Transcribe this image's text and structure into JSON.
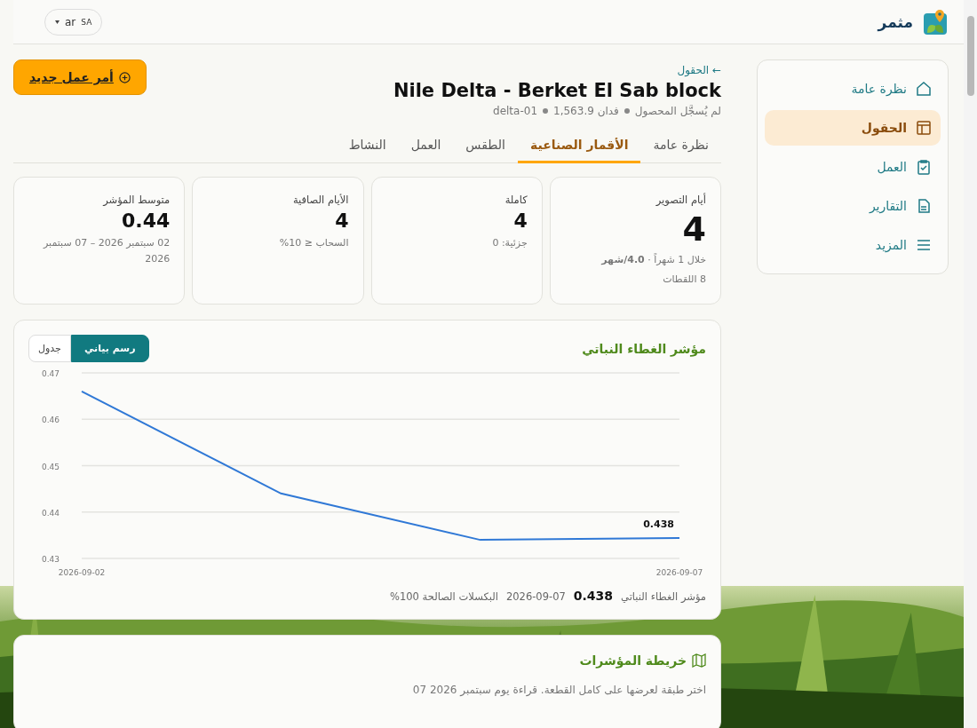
{
  "header": {
    "brand": "مثمر",
    "language": {
      "code": "ar",
      "region": "SA"
    }
  },
  "sidebar": {
    "items": [
      {
        "label": "نظرة عامة",
        "selected": false
      },
      {
        "label": "الحقول",
        "selected": true
      },
      {
        "label": "العمل",
        "selected": false
      },
      {
        "label": "التقارير",
        "selected": false
      },
      {
        "label": "المزيد",
        "selected": false
      }
    ]
  },
  "page": {
    "breadcrumb": "← الحقول",
    "title": "Nile Delta - Berket El Sab block",
    "meta": [
      "لم يُسجَّل المحصول",
      "فدان 1,563.9",
      "delta-01"
    ],
    "action": "أمر عمل جديد"
  },
  "tabs": [
    {
      "label": "نظرة عامة",
      "selected": false
    },
    {
      "label": "الأقمار الصناعية",
      "selected": true
    },
    {
      "label": "الطقس",
      "selected": false
    },
    {
      "label": "العمل",
      "selected": false
    },
    {
      "label": "النشاط",
      "selected": false
    }
  ],
  "stats": [
    {
      "label": "أيام التصوير",
      "value": "4",
      "kind": "large",
      "notes": [
        "خلال 1 شهراً · **4.0/شهر**",
        "8 اللقطات"
      ]
    },
    {
      "label": "كاملة",
      "value": "4",
      "kind": "normal",
      "notes": [
        "جزئية: 0"
      ]
    },
    {
      "label": "الأيام الصافية",
      "value": "4",
      "kind": "normal",
      "notes": [
        "السحاب ≤ 10%"
      ]
    },
    {
      "label": "متوسط المؤشر",
      "value": "0.44",
      "kind": "normal",
      "notes": [
        "02 سبتمبر 2026 – 07 سبتمبر 2026"
      ]
    }
  ],
  "chart_card": {
    "title": "مؤشر الغطاء النباتي",
    "views": [
      {
        "label": "رسم بياني",
        "selected": true
      },
      {
        "label": "جدول",
        "selected": false
      }
    ],
    "chart_data": {
      "type": "line",
      "categories": [
        "2026-09-02",
        null,
        null,
        "2026-09-07"
      ],
      "ylim": [
        0.43,
        0.47
      ],
      "yticks": [
        0.43,
        0.44,
        0.45,
        0.46,
        0.47
      ],
      "series": [
        {
          "color": "#2f78d6",
          "values": [
            0.466,
            0.444,
            0.434,
            0.4344
          ]
        }
      ],
      "grid": true,
      "annotations": [
        {
          "x": "2026-09-07",
          "y": 0.4345,
          "text": "0.438"
        }
      ]
    },
    "footer": {
      "label": "مؤشر الغطاء النباتي",
      "value": "0.438",
      "date": "2026-09-07",
      "pixels": "البكسلات الصالحة 100%"
    }
  },
  "map_card": {
    "title": "خريطة المؤشرات",
    "description": "اختر طبقة لعرضها على كامل القطعة. قراءة يوم سبتمبر 2026 07"
  }
}
